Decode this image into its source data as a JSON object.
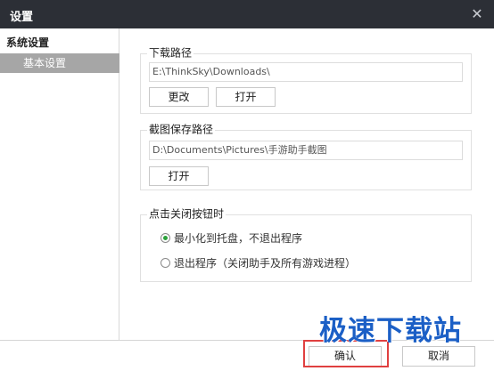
{
  "window": {
    "title": "设置",
    "close_glyph": "✕"
  },
  "sidebar": {
    "group_label": "系统设置",
    "items": [
      {
        "label": "基本设置",
        "selected": true
      }
    ]
  },
  "download": {
    "legend": "下载路径",
    "path": "E:\\ThinkSky\\Downloads\\",
    "change_label": "更改",
    "open_label": "打开"
  },
  "screenshot": {
    "legend": "截图保存路径",
    "path": "D:\\Documents\\Pictures\\手游助手截图",
    "open_label": "打开"
  },
  "close_behavior": {
    "legend": "点击关闭按钮时",
    "options": [
      {
        "label": "最小化到托盘，不退出程序",
        "checked": true
      },
      {
        "label": "退出程序（关闭助手及所有游戏进程）",
        "checked": false
      }
    ]
  },
  "footer": {
    "ok_label": "确认",
    "cancel_label": "取消"
  },
  "watermark": {
    "text": "极速下载站"
  },
  "colors": {
    "titlebar": "#2c2f36",
    "sidebar_selected": "#a6a6a6",
    "radio_checked": "#2aa13a",
    "watermark": "#1b5fc6",
    "highlight_box": "#e04040"
  },
  "icons": {
    "close": "close-icon"
  }
}
